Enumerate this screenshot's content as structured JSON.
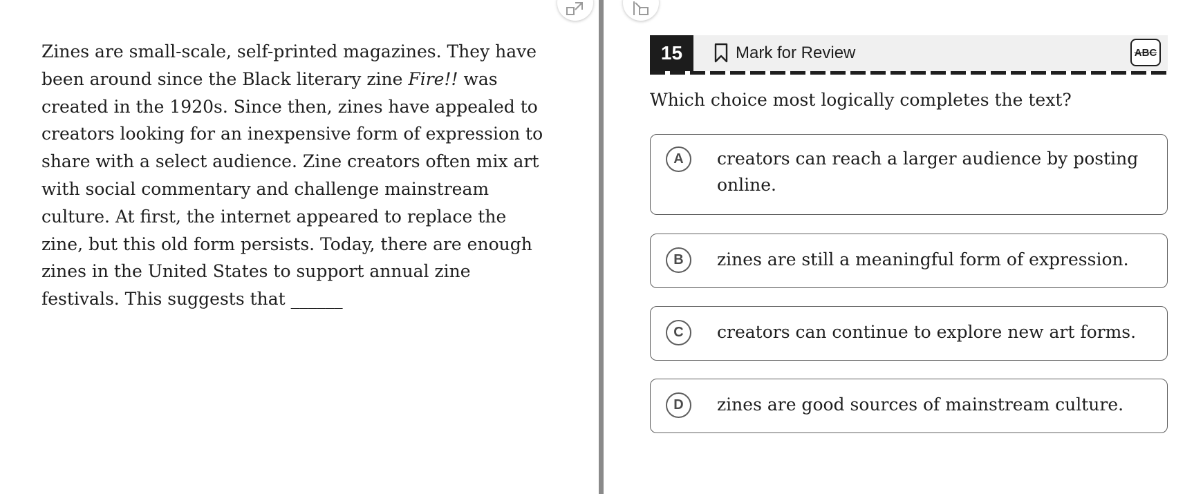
{
  "passage": {
    "text_before": "Zines are small-scale, self-printed magazines. They have been around since the Black literary zine ",
    "italic_title": "Fire!!",
    "text_after": " was created in the 1920s. Since then, zines have appealed to creators looking for an inexpensive form of expression to share with a select audience. Zine creators often mix art with social commentary and challenge mainstream culture. At first, the internet appeared to replace the zine, but this old form persists. Today, there are enough zines in the United States to support annual zine festivals. This suggests that ",
    "blank": "______"
  },
  "header": {
    "question_number": "15",
    "mark_for_review_label": "Mark for Review",
    "eliminator_label": "ABC"
  },
  "question": {
    "prompt": "Which choice most logically completes the text?"
  },
  "choices": [
    {
      "letter": "A",
      "text": "creators can reach a larger audience by posting online."
    },
    {
      "letter": "B",
      "text": "zines are still a meaningful form of expression."
    },
    {
      "letter": "C",
      "text": "creators can continue to explore new art forms."
    },
    {
      "letter": "D",
      "text": "zines are good sources of mainstream culture."
    }
  ],
  "icons": {
    "left_pane_toggle": "expand-icon",
    "right_pane_toggle": "collapse-icon",
    "bookmark": "bookmark-icon"
  }
}
